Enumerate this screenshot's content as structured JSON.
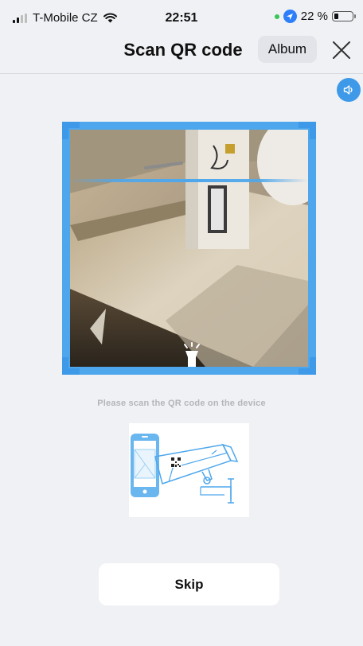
{
  "status_bar": {
    "carrier": "T-Mobile CZ",
    "time": "22:51",
    "battery": "22 %",
    "battery_level_percent": 22,
    "icons": [
      "signal-icon",
      "wifi-icon",
      "location-icon",
      "battery-icon"
    ]
  },
  "header": {
    "title": "Scan QR code",
    "album_label": "Album",
    "close_icon": "close-icon"
  },
  "sound_icon": "speaker-icon",
  "scanner": {
    "frame_color": "#4ea7ec",
    "torch_icon": "flashlight-icon"
  },
  "instruction": "Please scan the QR code on the device",
  "illustration_icon": "phone-scanning-camera-illustration",
  "skip_label": "Skip",
  "colors": {
    "background": "#f0f1f4",
    "accent": "#3e9ae8",
    "button_bg": "#ffffff"
  }
}
